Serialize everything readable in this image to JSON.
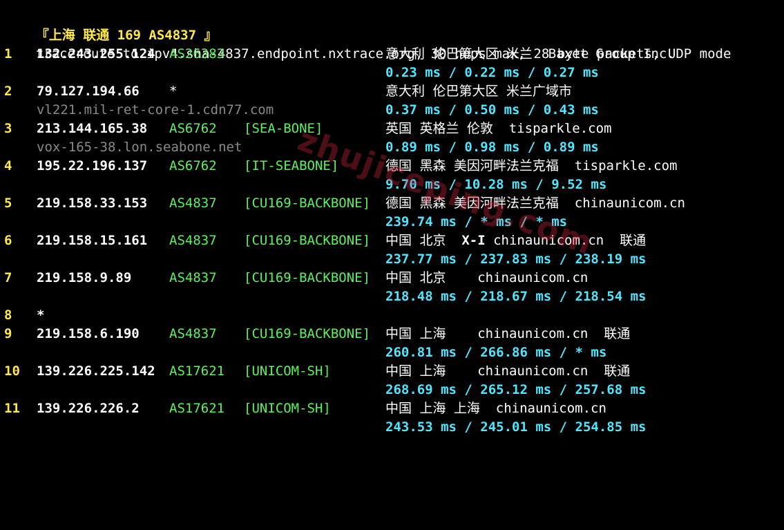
{
  "header": {
    "title": "『上海 联通 169 AS4837 』",
    "command": "traceroute to ipv4.sha-4837.endpoint.nxtrace.org, 30 hops max, 28 byte packets, UDP mode"
  },
  "hops": [
    {
      "num": "1",
      "ip": "132.243.255.124",
      "asn": "AS26383",
      "tag": "",
      "geo": "意大利 伦巴第大区 米兰  Baxet Group Inc.",
      "hostname": "",
      "rtt": "0.23 ms / 0.22 ms / 0.27 ms"
    },
    {
      "num": "2",
      "ip": "79.127.194.66",
      "asn": "*",
      "tag": "",
      "geo": "意大利 伦巴第大区 米兰广域市",
      "hostname": "vl221.mil-ret-core-1.cdn77.com",
      "rtt": "0.37 ms / 0.50 ms / 0.43 ms"
    },
    {
      "num": "3",
      "ip": "213.144.165.38",
      "asn": "AS6762",
      "tag": "[SEA-BONE]",
      "geo": "英国 英格兰 伦敦  tisparkle.com",
      "hostname": "vox-165-38.lon.seabone.net",
      "rtt": "0.89 ms / 0.98 ms / 0.89 ms"
    },
    {
      "num": "4",
      "ip": "195.22.196.137",
      "asn": "AS6762",
      "tag": "[IT-SEABONE]",
      "geo": "德国 黑森 美因河畔法兰克福  tisparkle.com",
      "hostname": "",
      "rtt": "9.70 ms / 10.28 ms / 9.52 ms"
    },
    {
      "num": "5",
      "ip": "219.158.33.153",
      "asn": "AS4837",
      "tag": "[CU169-BACKBONE]",
      "geo": "德国 黑森 美因河畔法兰克福  chinaunicom.cn",
      "hostname": "",
      "rtt": "239.74 ms / * ms / * ms"
    },
    {
      "num": "6",
      "ip": "219.158.15.161",
      "asn": "AS4837",
      "tag": "[CU169-BACKBONE]",
      "geo_pre": "中国 北京  ",
      "geo_bold": "X-I",
      "geo": " chinaunicom.cn  联通",
      "hostname": "",
      "rtt": "237.77 ms / 237.83 ms / 238.19 ms"
    },
    {
      "num": "7",
      "ip": "219.158.9.89",
      "asn": "AS4837",
      "tag": "[CU169-BACKBONE]",
      "geo": "中国 北京    chinaunicom.cn",
      "hostname": "",
      "rtt": "218.48 ms / 218.67 ms / 218.54 ms"
    },
    {
      "num": "8",
      "ip": "*",
      "asn": "",
      "tag": "",
      "geo": "",
      "hostname": "",
      "rtt": ""
    },
    {
      "num": "9",
      "ip": "219.158.6.190",
      "asn": "AS4837",
      "tag": "[CU169-BACKBONE]",
      "geo": "中国 上海    chinaunicom.cn  联通",
      "hostname": "",
      "rtt": "260.81 ms / 266.86 ms / * ms"
    },
    {
      "num": "10",
      "ip": "139.226.225.142",
      "asn": "AS17621",
      "tag": "[UNICOM-SH]",
      "geo": "中国 上海    chinaunicom.cn  联通",
      "hostname": "",
      "rtt": "268.69 ms / 265.12 ms / 257.68 ms"
    },
    {
      "num": "11",
      "ip": "139.226.226.2",
      "asn": "AS17621",
      "tag": "[UNICOM-SH]",
      "geo": "中国 上海 上海  chinaunicom.cn",
      "hostname": "",
      "rtt": "243.53 ms / 245.01 ms / 254.85 ms"
    }
  ],
  "watermark": "zhujiceping.com",
  "colors": {
    "background": "#000000",
    "hop_number": "#ffe94a",
    "asn": "#5cf25c",
    "rtt": "#4fe6ff",
    "hostname": "#8a8a8a"
  }
}
